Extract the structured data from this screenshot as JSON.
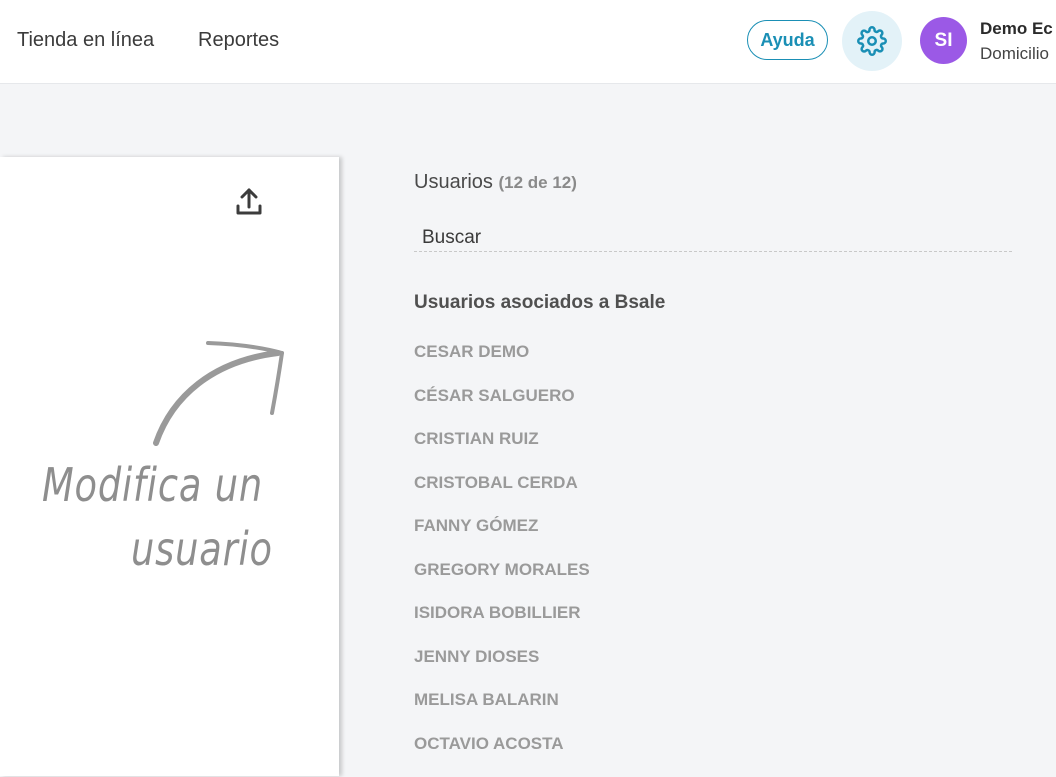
{
  "nav": {
    "items": [
      {
        "label": "Tienda en línea"
      },
      {
        "label": "Reportes"
      }
    ]
  },
  "header": {
    "help_label": "Ayuda",
    "avatar_initials": "SI",
    "user_name": "Demo Ec",
    "user_sub": "Domicilio"
  },
  "sidebar": {
    "hint_line1": "Modifica un",
    "hint_line2": "usuario"
  },
  "users": {
    "title": "Usuarios",
    "count": "(12 de 12)",
    "search_placeholder": "Buscar",
    "group_title": "Usuarios asociados a Bsale",
    "list": [
      "CESAR DEMO",
      "CÉSAR SALGUERO",
      "CRISTIAN RUIZ",
      "CRISTOBAL CERDA",
      "FANNY GÓMEZ",
      "GREGORY MORALES",
      "ISIDORA BOBILLIER",
      "JENNY DIOSES",
      "MELISA BALARIN",
      "OCTAVIO ACOSTA"
    ]
  },
  "colors": {
    "accent": "#1a8fb5",
    "avatar_bg": "#9b59e6",
    "page_bg": "#f4f5f7"
  }
}
